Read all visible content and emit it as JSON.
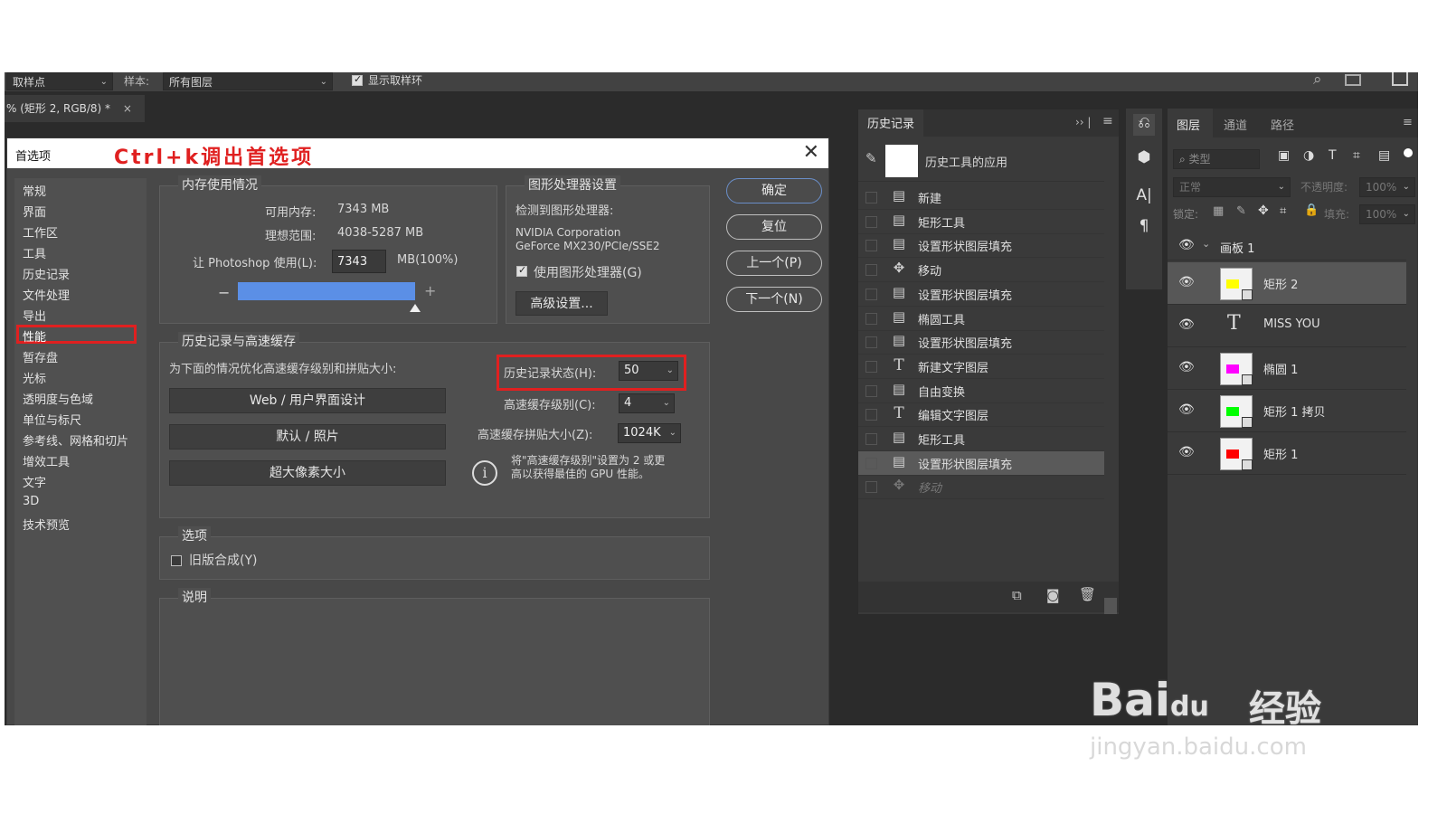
{
  "option_bar": {
    "sample_point_label": "取样点",
    "sample_label": "样本:",
    "sample_value": "所有图层",
    "show_ring_label": "显示取样环"
  },
  "document_tab": {
    "title": "% (矩形 2, RGB/8) *",
    "close": "×"
  },
  "dialog": {
    "title": "首选项",
    "annotation": "Ctrl+k调出首选项",
    "close": "✕",
    "nav": [
      "常规",
      "界面",
      "工作区",
      "工具",
      "历史记录",
      "文件处理",
      "导出",
      "性能",
      "暂存盘",
      "光标",
      "透明度与色域",
      "单位与标尺",
      "参考线、网格和切片",
      "增效工具",
      "文字",
      "3D",
      "技术预览"
    ],
    "nav_selected": "性能",
    "memory": {
      "label": "内存使用情况",
      "available_label": "可用内存:",
      "available_value": "7343 MB",
      "ideal_label": "理想范围:",
      "ideal_value": "4038-5287 MB",
      "use_label": "让 Photoshop 使用(L):",
      "use_value": "7343",
      "use_unit": "MB(100%)",
      "slider_minus": "−",
      "slider_plus": "+",
      "slider_fraction": 1.0
    },
    "gpu": {
      "label": "图形处理器设置",
      "detected_label": "检测到图形处理器:",
      "vendor": "NVIDIA Corporation",
      "model": "GeForce MX230/PCIe/SSE2",
      "use_gpu_label": "使用图形处理器(G)",
      "use_gpu_checked": true,
      "advanced_button": "高级设置..."
    },
    "buttons": {
      "ok": "确定",
      "reset": "复位",
      "prev": "上一个(P)",
      "next": "下一个(N)"
    },
    "history_cache": {
      "label": "历史记录与高速缓存",
      "optimize_label": "为下面的情况优化高速缓存级别和拼贴大小:",
      "preset_web": "Web / 用户界面设计",
      "preset_default": "默认 / 照片",
      "preset_huge": "超大像素大小",
      "states_label": "历史记录状态(H):",
      "states_value": "50",
      "cache_levels_label": "高速缓存级别(C):",
      "cache_levels_value": "4",
      "tile_size_label": "高速缓存拼贴大小(Z):",
      "tile_size_value": "1024K",
      "info_line1": "将\"高速缓存级别\"设置为 2 或更",
      "info_line2": "高以获得最佳的 GPU 性能。"
    },
    "options": {
      "label": "选项",
      "legacy_label": "旧版合成(Y)",
      "legacy_checked": false
    },
    "description": {
      "label": "说明"
    }
  },
  "history_panel": {
    "tab": "历史记录",
    "snapshot_label": "历史工具的应用",
    "items": [
      {
        "icon": "doc",
        "label": "新建",
        "style": "normal"
      },
      {
        "icon": "doc",
        "label": "矩形工具",
        "style": "normal"
      },
      {
        "icon": "doc",
        "label": "设置形状图层填充",
        "style": "normal"
      },
      {
        "icon": "move",
        "label": "移动",
        "style": "normal"
      },
      {
        "icon": "doc",
        "label": "设置形状图层填充",
        "style": "normal"
      },
      {
        "icon": "doc",
        "label": "椭圆工具",
        "style": "normal"
      },
      {
        "icon": "doc",
        "label": "设置形状图层填充",
        "style": "normal"
      },
      {
        "icon": "text",
        "label": "新建文字图层",
        "style": "normal"
      },
      {
        "icon": "doc",
        "label": "自由变换",
        "style": "normal"
      },
      {
        "icon": "text",
        "label": "编辑文字图层",
        "style": "normal"
      },
      {
        "icon": "doc",
        "label": "矩形工具",
        "style": "normal"
      },
      {
        "icon": "doc",
        "label": "设置形状图层填充",
        "style": "selected"
      },
      {
        "icon": "move",
        "label": "移动",
        "style": "dimmed"
      }
    ]
  },
  "layers_panel": {
    "tabs": [
      "图层",
      "通道",
      "路径"
    ],
    "kind_label": "类型",
    "blend_mode": "正常",
    "opacity_label": "不透明度:",
    "opacity_value": "100%",
    "lock_label": "锁定:",
    "fill_label": "填充:",
    "fill_value": "100%",
    "artboard": "画板 1",
    "layers": [
      {
        "name": "矩形 2",
        "kind": "shape",
        "color": "#ffff00",
        "selected": true
      },
      {
        "name": "MISS YOU",
        "kind": "text",
        "color": "",
        "selected": false
      },
      {
        "name": "椭圆 1",
        "kind": "shape",
        "color": "#ff00ff",
        "selected": false
      },
      {
        "name": "矩形 1 拷贝",
        "kind": "shape",
        "color": "#00ff00",
        "selected": false
      },
      {
        "name": "矩形 1",
        "kind": "shape",
        "color": "#ff0000",
        "selected": false
      }
    ]
  },
  "watermark": {
    "brand": "Bai",
    "brand_paw": "du",
    "brand_cn": "经验",
    "url": "jingyan.baidu.com"
  }
}
